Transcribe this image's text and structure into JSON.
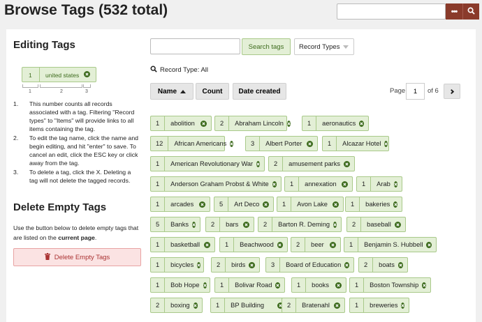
{
  "header": {
    "title": "Browse Tags (532 total)",
    "search_placeholder": "",
    "more_label": "•••",
    "search_icon": "magnifier-icon"
  },
  "editing": {
    "heading": "Editing Tags",
    "demo_tag": {
      "count": "1",
      "name": "united states"
    },
    "bracket_labels": [
      "1",
      "2",
      "3"
    ],
    "steps": [
      {
        "num": "1.",
        "text": "This number counts all records associated with a tag. Filtering \"Record types\" to \"Items\" will provide links to all items containing the tag."
      },
      {
        "num": "2.",
        "text": "To edit the tag name, click the name and begin editing, and hit \"enter\" to save. To cancel an edit, click the ESC key or click away from the tag."
      },
      {
        "num": "3.",
        "text": "To delete a tag, click the X. Deleting a tag will not delete the tagged records."
      }
    ]
  },
  "delete_empty": {
    "heading": "Delete Empty Tags",
    "desc_prefix": "Use the button below to delete empty tags that are listed on the ",
    "desc_bold": "current page",
    "desc_suffix": ".",
    "button_label": "Delete Empty Tags"
  },
  "controls": {
    "search_value": "",
    "search_button": "Search tags",
    "record_types": "Record Types",
    "filter_label": "Record Type: All",
    "sort": {
      "name": "Name",
      "count": "Count",
      "date": "Date created"
    },
    "page_label": "Page",
    "page_value": "1",
    "page_of": "of 6"
  },
  "tags": [
    [
      {
        "c": "1",
        "t": "abolition"
      },
      {
        "c": "2",
        "t": "Abraham Lincoln"
      },
      {
        "c": "1",
        "t": "aeronautics"
      }
    ],
    [
      {
        "c": "12",
        "t": "African Americans"
      },
      {
        "c": "3",
        "t": "Albert Porter"
      },
      {
        "c": "1",
        "t": "Alcazar Hotel"
      }
    ],
    [
      {
        "c": "1",
        "t": "American Revolutionary War"
      },
      {
        "c": "2",
        "t": "amusement parks"
      }
    ],
    [
      {
        "c": "1",
        "t": "Anderson Graham Probst & White"
      },
      {
        "c": "1",
        "t": "annexation"
      },
      {
        "c": "1",
        "t": "Arab"
      }
    ],
    [
      {
        "c": "1",
        "t": "arcades"
      },
      {
        "c": "5",
        "t": "Art Deco"
      },
      {
        "c": "1",
        "t": "Avon Lake"
      },
      {
        "c": "1",
        "t": "bakeries"
      }
    ],
    [
      {
        "c": "5",
        "t": "Banks"
      },
      {
        "c": "2",
        "t": "bars"
      },
      {
        "c": "2",
        "t": "Barton R. Deming"
      },
      {
        "c": "2",
        "t": "baseball"
      }
    ],
    [
      {
        "c": "1",
        "t": "basketball"
      },
      {
        "c": "1",
        "t": "Beachwood"
      },
      {
        "c": "2",
        "t": "beer"
      },
      {
        "c": "1",
        "t": "Benjamin S. Hubbell"
      }
    ],
    [
      {
        "c": "1",
        "t": "bicycles"
      },
      {
        "c": "2",
        "t": "birds"
      },
      {
        "c": "3",
        "t": "Board of Education"
      },
      {
        "c": "2",
        "t": "boats"
      }
    ],
    [
      {
        "c": "1",
        "t": "Bob Hope"
      },
      {
        "c": "1",
        "t": "Bolivar Road"
      },
      {
        "c": "1",
        "t": "books"
      },
      {
        "c": "1",
        "t": "Boston Township"
      }
    ],
    [
      {
        "c": "2",
        "t": "boxing"
      },
      {
        "c": "1",
        "t": "BP Building"
      },
      {
        "c": "2",
        "t": "Bratenahl"
      },
      {
        "c": "1",
        "t": "breweries"
      }
    ]
  ]
}
